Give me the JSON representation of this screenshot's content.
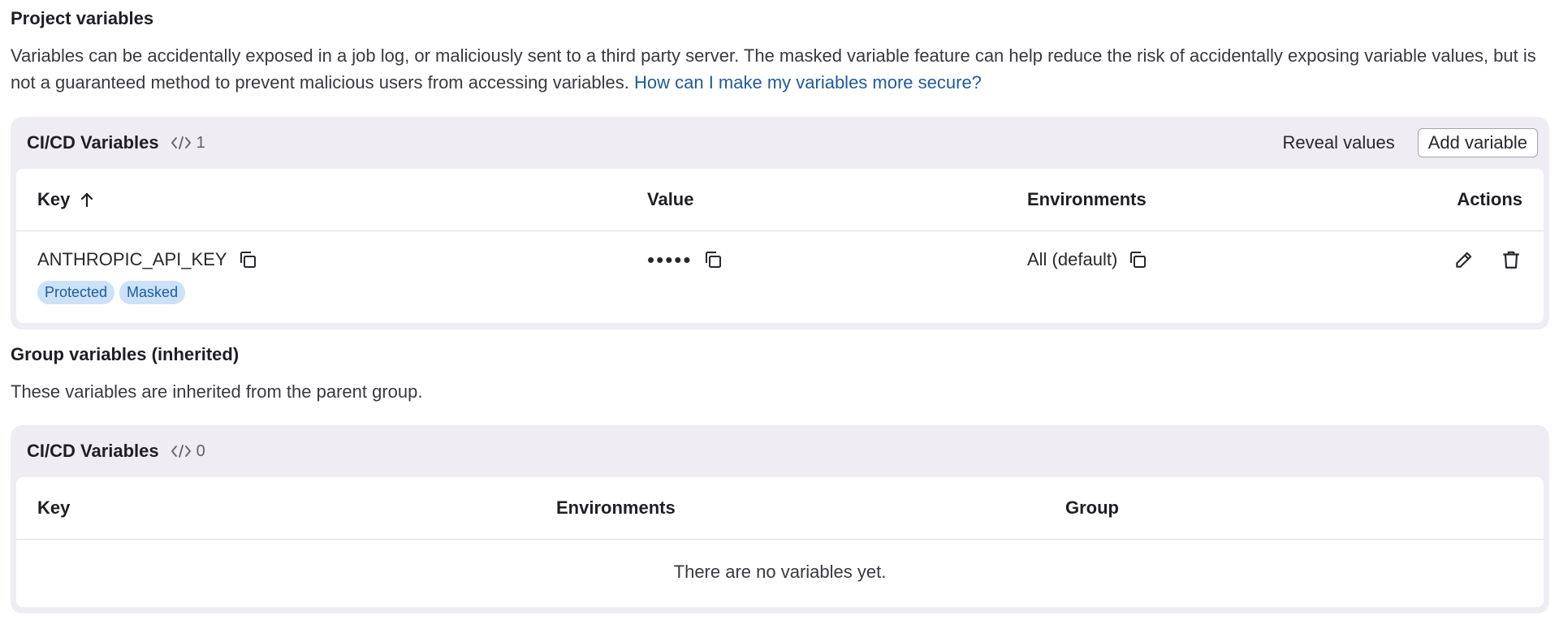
{
  "project": {
    "title": "Project variables",
    "description": "Variables can be accidentally exposed in a job log, or maliciously sent to a third party server. The masked variable feature can help reduce the risk of accidentally exposing variable values, but is not a guaranteed method to prevent malicious users from accessing variables.",
    "help_link": "How can I make my variables more secure?",
    "card": {
      "title": "CI/CD Variables",
      "count": "1",
      "reveal_label": "Reveal values",
      "add_label": "Add variable",
      "columns": {
        "key": "Key",
        "value": "Value",
        "environments": "Environments",
        "actions": "Actions"
      },
      "rows": [
        {
          "key": "ANTHROPIC_API_KEY",
          "value": "•••••",
          "environment": "All (default)",
          "badges": [
            "Protected",
            "Masked"
          ]
        }
      ]
    }
  },
  "group": {
    "title": "Group variables (inherited)",
    "description": "These variables are inherited from the parent group.",
    "card": {
      "title": "CI/CD Variables",
      "count": "0",
      "columns": {
        "key": "Key",
        "environments": "Environments",
        "group": "Group"
      },
      "empty_message": "There are no variables yet."
    }
  },
  "icons": {
    "count_icon": "code-icon",
    "copy_icon": "copy-icon",
    "sort_icon": "arrow-up-icon",
    "edit_icon": "pencil-icon",
    "delete_icon": "trash-icon"
  },
  "colors": {
    "card_bg": "#efecf3",
    "badge_bg": "#cbe2f9",
    "badge_text": "#1f5a9b",
    "link": "#1f5a9b"
  }
}
